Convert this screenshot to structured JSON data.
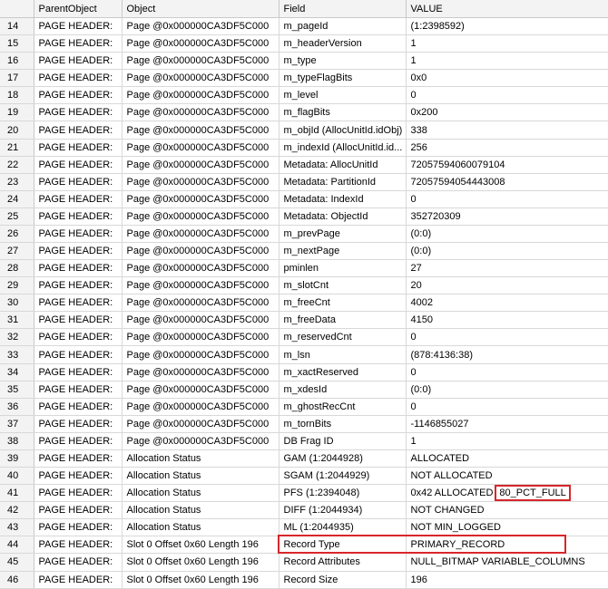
{
  "grid": {
    "columns": [
      "",
      "ParentObject",
      "Object",
      "Field",
      "VALUE"
    ],
    "rows": [
      {
        "n": "14",
        "parent": "PAGE HEADER:",
        "object": "Page @0x000000CA3DF5C000",
        "field": "m_pageId",
        "value": "(1:2398592)"
      },
      {
        "n": "15",
        "parent": "PAGE HEADER:",
        "object": "Page @0x000000CA3DF5C000",
        "field": "m_headerVersion",
        "value": "1"
      },
      {
        "n": "16",
        "parent": "PAGE HEADER:",
        "object": "Page @0x000000CA3DF5C000",
        "field": "m_type",
        "value": "1"
      },
      {
        "n": "17",
        "parent": "PAGE HEADER:",
        "object": "Page @0x000000CA3DF5C000",
        "field": "m_typeFlagBits",
        "value": "0x0"
      },
      {
        "n": "18",
        "parent": "PAGE HEADER:",
        "object": "Page @0x000000CA3DF5C000",
        "field": "m_level",
        "value": "0"
      },
      {
        "n": "19",
        "parent": "PAGE HEADER:",
        "object": "Page @0x000000CA3DF5C000",
        "field": "m_flagBits",
        "value": "0x200"
      },
      {
        "n": "20",
        "parent": "PAGE HEADER:",
        "object": "Page @0x000000CA3DF5C000",
        "field": "m_objId (AllocUnitId.idObj)",
        "value": "338"
      },
      {
        "n": "21",
        "parent": "PAGE HEADER:",
        "object": "Page @0x000000CA3DF5C000",
        "field": "m_indexId (AllocUnitId.id...",
        "value": "256"
      },
      {
        "n": "22",
        "parent": "PAGE HEADER:",
        "object": "Page @0x000000CA3DF5C000",
        "field": "Metadata: AllocUnitId",
        "value": "72057594060079104"
      },
      {
        "n": "23",
        "parent": "PAGE HEADER:",
        "object": "Page @0x000000CA3DF5C000",
        "field": "Metadata: PartitionId",
        "value": "72057594054443008"
      },
      {
        "n": "24",
        "parent": "PAGE HEADER:",
        "object": "Page @0x000000CA3DF5C000",
        "field": "Metadata: IndexId",
        "value": "0"
      },
      {
        "n": "25",
        "parent": "PAGE HEADER:",
        "object": "Page @0x000000CA3DF5C000",
        "field": "Metadata: ObjectId",
        "value": "352720309"
      },
      {
        "n": "26",
        "parent": "PAGE HEADER:",
        "object": "Page @0x000000CA3DF5C000",
        "field": "m_prevPage",
        "value": "(0:0)"
      },
      {
        "n": "27",
        "parent": "PAGE HEADER:",
        "object": "Page @0x000000CA3DF5C000",
        "field": "m_nextPage",
        "value": "(0:0)"
      },
      {
        "n": "28",
        "parent": "PAGE HEADER:",
        "object": "Page @0x000000CA3DF5C000",
        "field": "pminlen",
        "value": "27"
      },
      {
        "n": "29",
        "parent": "PAGE HEADER:",
        "object": "Page @0x000000CA3DF5C000",
        "field": "m_slotCnt",
        "value": "20"
      },
      {
        "n": "30",
        "parent": "PAGE HEADER:",
        "object": "Page @0x000000CA3DF5C000",
        "field": "m_freeCnt",
        "value": "4002"
      },
      {
        "n": "31",
        "parent": "PAGE HEADER:",
        "object": "Page @0x000000CA3DF5C000",
        "field": "m_freeData",
        "value": "4150"
      },
      {
        "n": "32",
        "parent": "PAGE HEADER:",
        "object": "Page @0x000000CA3DF5C000",
        "field": "m_reservedCnt",
        "value": "0"
      },
      {
        "n": "33",
        "parent": "PAGE HEADER:",
        "object": "Page @0x000000CA3DF5C000",
        "field": "m_lsn",
        "value": "(878:4136:38)"
      },
      {
        "n": "34",
        "parent": "PAGE HEADER:",
        "object": "Page @0x000000CA3DF5C000",
        "field": "m_xactReserved",
        "value": "0"
      },
      {
        "n": "35",
        "parent": "PAGE HEADER:",
        "object": "Page @0x000000CA3DF5C000",
        "field": "m_xdesId",
        "value": "(0:0)"
      },
      {
        "n": "36",
        "parent": "PAGE HEADER:",
        "object": "Page @0x000000CA3DF5C000",
        "field": "m_ghostRecCnt",
        "value": "0"
      },
      {
        "n": "37",
        "parent": "PAGE HEADER:",
        "object": "Page @0x000000CA3DF5C000",
        "field": "m_tornBits",
        "value": "-1146855027"
      },
      {
        "n": "38",
        "parent": "PAGE HEADER:",
        "object": "Page @0x000000CA3DF5C000",
        "field": "DB Frag ID",
        "value": "1"
      },
      {
        "n": "39",
        "parent": "PAGE HEADER:",
        "object": "Allocation Status",
        "field": "GAM (1:2044928)",
        "value": "ALLOCATED"
      },
      {
        "n": "40",
        "parent": "PAGE HEADER:",
        "object": "Allocation Status",
        "field": "SGAM (1:2044929)",
        "value": "NOT ALLOCATED"
      },
      {
        "n": "41",
        "parent": "PAGE HEADER:",
        "object": "Allocation Status",
        "field": "PFS (1:2394048)",
        "value": "0x42 ALLOCATED",
        "value_extra": "80_PCT_FULL"
      },
      {
        "n": "42",
        "parent": "PAGE HEADER:",
        "object": "Allocation Status",
        "field": "DIFF (1:2044934)",
        "value": "NOT CHANGED"
      },
      {
        "n": "43",
        "parent": "PAGE HEADER:",
        "object": "Allocation Status",
        "field": "ML (1:2044935)",
        "value": "NOT MIN_LOGGED"
      },
      {
        "n": "44",
        "parent": "PAGE HEADER:",
        "object": "Slot 0 Offset 0x60 Length 196",
        "field": "Record Type",
        "value": "PRIMARY_RECORD"
      },
      {
        "n": "45",
        "parent": "PAGE HEADER:",
        "object": "Slot 0 Offset 0x60 Length 196",
        "field": "Record Attributes",
        "value": " NULL_BITMAP VARIABLE_COLUMNS"
      },
      {
        "n": "46",
        "parent": "PAGE HEADER:",
        "object": "Slot 0 Offset 0x60 Length 196",
        "field": "Record Size",
        "value": "196"
      }
    ]
  },
  "colors": {
    "highlight": "#d7262b",
    "header_bg": "#f3f3f3",
    "grid_line": "#d8d8d8"
  }
}
